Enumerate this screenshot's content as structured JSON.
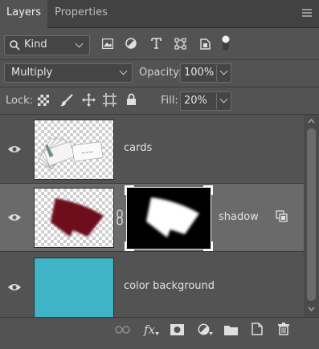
{
  "tabs": [
    {
      "label": "Layers",
      "active": true
    },
    {
      "label": "Properties",
      "active": false
    }
  ],
  "filter": {
    "kind_label": "Kind",
    "filter_icons": [
      "image-filter-icon",
      "adjustment-filter-icon",
      "type-filter-icon",
      "shape-filter-icon",
      "smart-object-filter-icon",
      "filter-toggle-icon"
    ]
  },
  "blend": {
    "mode": "Multiply",
    "opacity_label": "Opacity:",
    "opacity_value": "100%"
  },
  "lock": {
    "label": "Lock:",
    "fill_label": "Fill:",
    "fill_value": "20%"
  },
  "layers": [
    {
      "name": "cards",
      "visible": true,
      "selected": false
    },
    {
      "name": "shadow",
      "visible": true,
      "selected": true,
      "has_mask": true,
      "shadow_color": "#6e0b1e"
    },
    {
      "name": "color background",
      "visible": true,
      "selected": false,
      "fill_color": "#3fb4c7"
    }
  ],
  "bottom": {
    "fx_label": "fx"
  }
}
